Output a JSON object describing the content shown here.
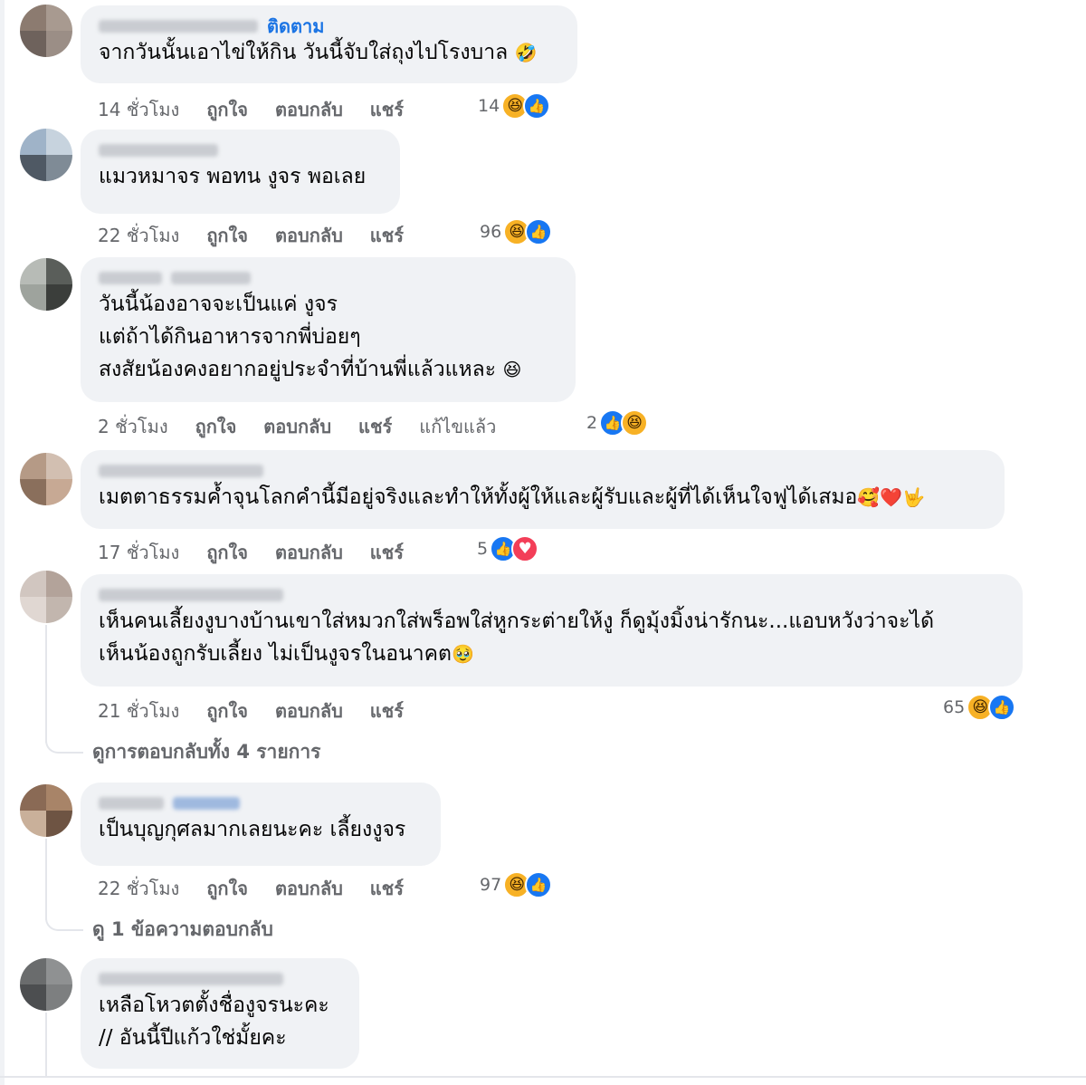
{
  "comments": [
    {
      "follow_label": "ติดตาม",
      "lines": [
        "จากวันนั้นเอาไข่ให้กิน วันนี้จับใส่ถุงไปโรงบาล"
      ],
      "emoji": "🤣",
      "time": "14 ชั่วโมง",
      "like": "ถูกใจ",
      "reply": "ตอบกลับ",
      "share": "แชร์",
      "reaction_count": "14",
      "reactions": [
        "haha-icon",
        "like-icon"
      ]
    },
    {
      "lines": [
        "แมวหมาจร พอทน งูจร พอเลย"
      ],
      "time": "22 ชั่วโมง",
      "like": "ถูกใจ",
      "reply": "ตอบกลับ",
      "share": "แชร์",
      "reaction_count": "96",
      "reactions": [
        "haha-icon",
        "like-icon"
      ]
    },
    {
      "lines": [
        "วันนี้น้องอาจจะเป็นแค่ งูจร",
        "แต่ถ้าได้กินอาหารจากพี่บ่อยๆ",
        "สงสัยน้องคงอยากอยู่ประจำที่บ้านพี่แล้วแหละ"
      ],
      "emoji": "😆",
      "time": "2 ชั่วโมง",
      "like": "ถูกใจ",
      "reply": "ตอบกลับ",
      "share": "แชร์",
      "edited": "แก้ไขแล้ว",
      "reaction_count": "2",
      "reactions": [
        "like-icon",
        "haha-icon"
      ]
    },
    {
      "lines": [
        "เมตตาธรรมค้ำจุนโลกคำนี้มีอยู่จริงและทำให้ทั้งผู้ให้และผู้รับและผู้ที่ได้เห็นใจฟูได้เสมอ"
      ],
      "emoji": "🥰❤️🤟",
      "time": "17 ชั่วโมง",
      "like": "ถูกใจ",
      "reply": "ตอบกลับ",
      "share": "แชร์",
      "reaction_count": "5",
      "reactions": [
        "like-icon",
        "love-icon"
      ]
    },
    {
      "lines": [
        "เห็นคนเลี้ยงงูบางบ้านเขาใส่หมวกใส่พร็อพใส่หูกระต่ายให้งู ก็ดูมุ้งมิ้งน่ารักนะ...แอบหวังว่าจะได้",
        "เห็นน้องถูกรับเลี้ยง ไม่เป็นงูจรในอนาคต"
      ],
      "emoji": "🥹",
      "time": "21 ชั่วโมง",
      "like": "ถูกใจ",
      "reply": "ตอบกลับ",
      "share": "แชร์",
      "reaction_count": "65",
      "reactions": [
        "haha-icon",
        "like-icon"
      ],
      "view_replies": "ดูการตอบกลับทั้ง 4 รายการ"
    },
    {
      "lines": [
        "เป็นบุญกุศลมากเลยนะคะ เลี้ยงงูจร"
      ],
      "time": "22 ชั่วโมง",
      "like": "ถูกใจ",
      "reply": "ตอบกลับ",
      "share": "แชร์",
      "reaction_count": "97",
      "reactions": [
        "haha-icon",
        "like-icon"
      ],
      "view_replies": "ดู 1 ข้อความตอบกลับ"
    },
    {
      "lines": [
        "เหลือโหวตตั้งชื่องูจรนะคะ",
        "// อันนี้ปีแก้วใช่มั้ยคะ"
      ]
    }
  ],
  "colors": {
    "bubble": "#f0f2f5",
    "meta_text": "#65676b",
    "link_blue": "#1b74e4",
    "haha": "#f7b125",
    "like": "#1877f2",
    "love": "#f33e58"
  }
}
